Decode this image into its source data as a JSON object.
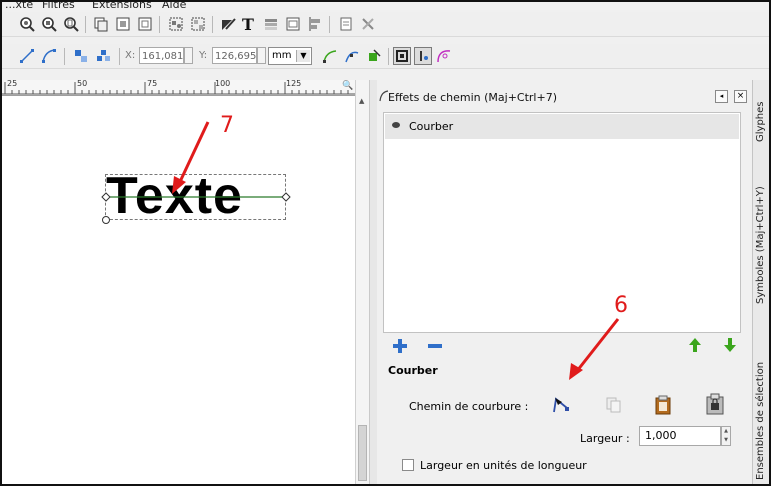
{
  "menu": {
    "items": [
      "...xte",
      "Filtres",
      "Extensions",
      "Aide"
    ]
  },
  "toolbar2": {
    "x_label": "X:",
    "x_value": "161,081",
    "y_label": "Y:",
    "y_value": "126,695",
    "unit": "mm"
  },
  "ruler": {
    "ticks": [
      "25",
      "50",
      "75",
      "100",
      "125"
    ]
  },
  "canvas": {
    "text": "Texte"
  },
  "panel": {
    "title": "Effets de chemin (Maj+Ctrl+7)",
    "effects": [
      {
        "label": "Courber"
      }
    ],
    "section_title": "Courber",
    "path_label": "Chemin de courbure :",
    "width_label": "Largeur :",
    "width_value": "1,000",
    "checkbox_label": "Largeur en unités de longueur"
  },
  "side_tabs": [
    "Glyphes",
    "Symboles (Maj+Ctrl+Y)",
    "Ensembles de sélection"
  ],
  "annotations": {
    "left_number": "7",
    "right_number": "6"
  },
  "colors": {
    "annotation_red": "#e01b1b",
    "accent_blue": "#2f6fc9",
    "accent_green": "#3aa51c"
  }
}
